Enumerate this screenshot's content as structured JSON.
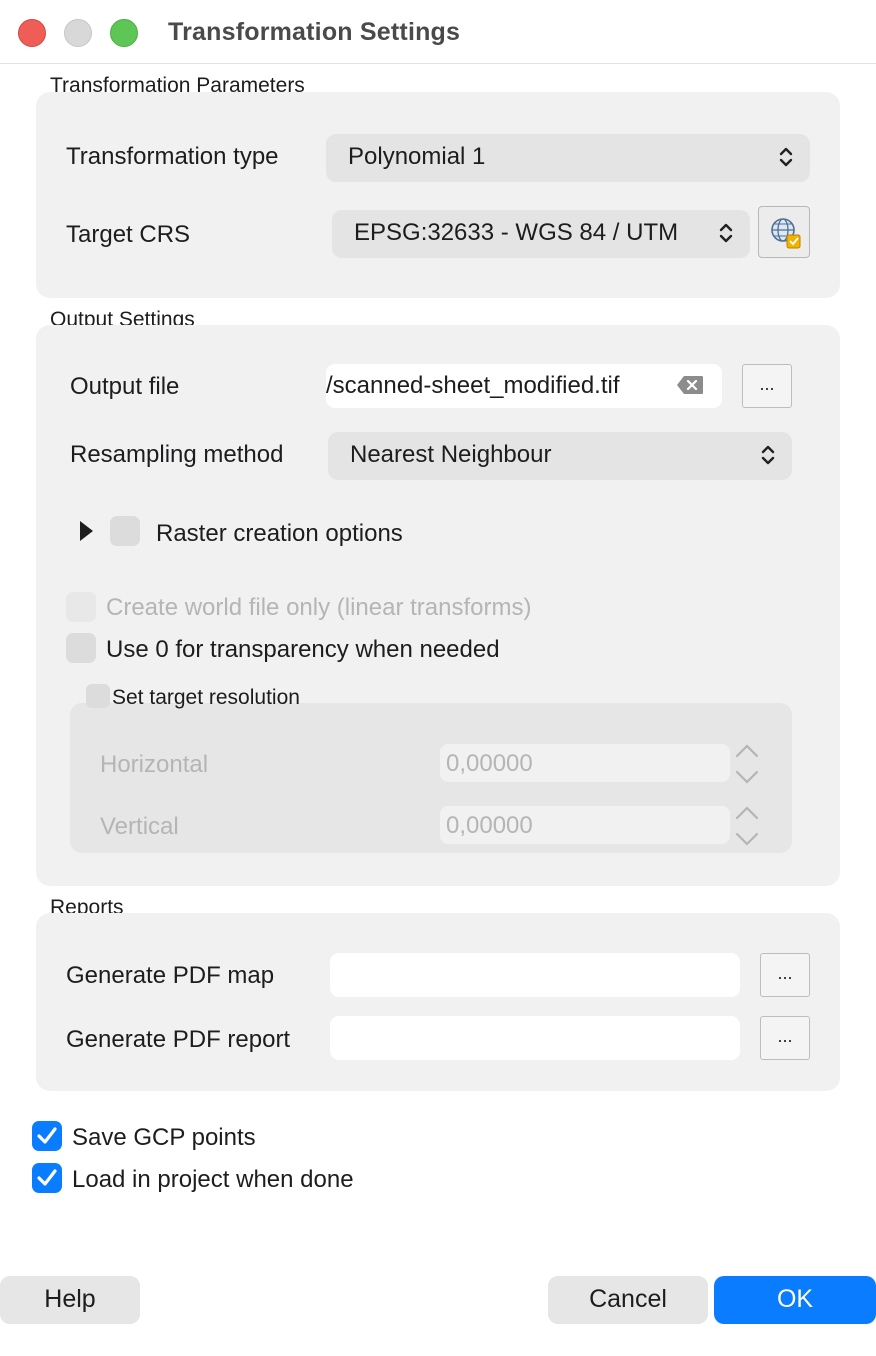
{
  "window": {
    "title": "Transformation Settings"
  },
  "transformation_parameters": {
    "group_title": "Transformation Parameters",
    "type_label": "Transformation type",
    "type_value": "Polynomial 1",
    "crs_label": "Target CRS",
    "crs_value": "EPSG:32633 - WGS 84 / UTM"
  },
  "output_settings": {
    "group_title": "Output Settings",
    "output_file_label": "Output file",
    "output_file_value": "/scanned-sheet_modified.tif",
    "browse_label": "...",
    "resampling_label": "Resampling method",
    "resampling_value": "Nearest Neighbour",
    "raster_options_label": "Raster creation options",
    "world_file_label": "Create world file only (linear transforms)",
    "transparency_label": "Use 0 for transparency when needed",
    "target_resolution": {
      "title": "Set target resolution",
      "horizontal_label": "Horizontal",
      "horizontal_value": "0,00000",
      "vertical_label": "Vertical",
      "vertical_value": "0,00000"
    }
  },
  "reports": {
    "group_title": "Reports",
    "pdf_map_label": "Generate PDF map",
    "pdf_map_value": "",
    "pdf_report_label": "Generate PDF report",
    "pdf_report_value": "",
    "browse_label": "..."
  },
  "options": {
    "save_gcp_label": "Save GCP points",
    "save_gcp_checked": true,
    "load_project_label": "Load in project when done",
    "load_project_checked": true
  },
  "buttons": {
    "help": "Help",
    "cancel": "Cancel",
    "ok": "OK"
  },
  "colors": {
    "accent": "#0a7cff",
    "close": "#ee5e57",
    "zoom": "#5dc655"
  }
}
